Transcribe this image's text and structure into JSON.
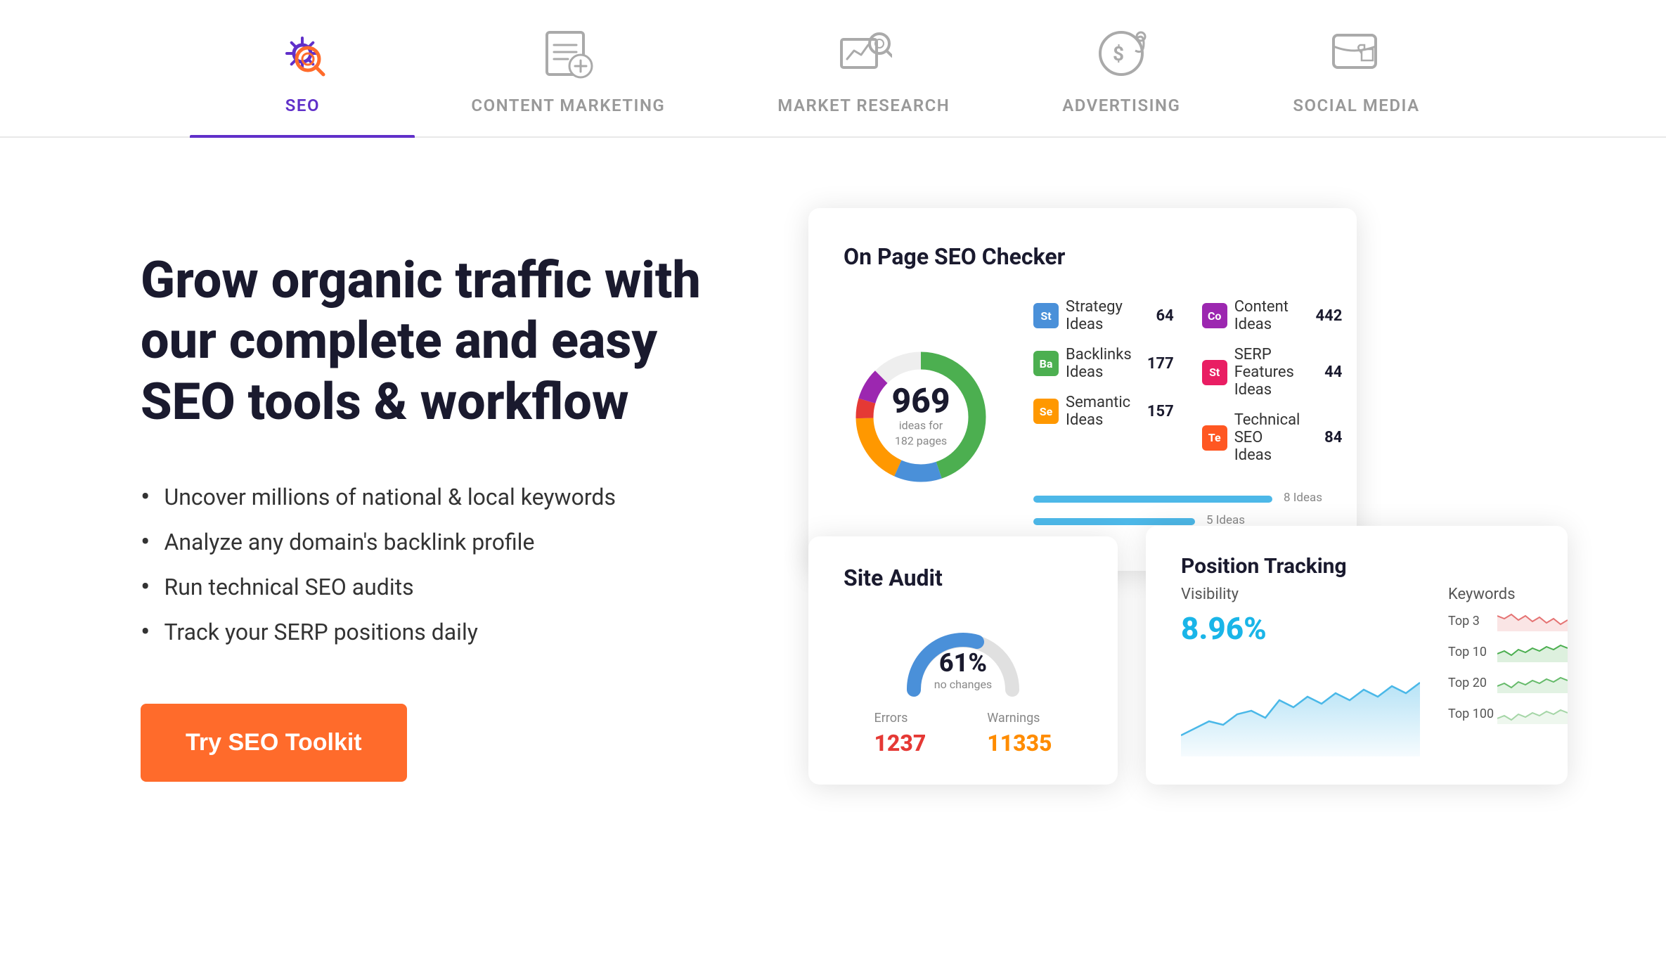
{
  "nav": {
    "tabs": [
      {
        "id": "seo",
        "label": "SEO",
        "active": true
      },
      {
        "id": "content-marketing",
        "label": "CONTENT MARKETING",
        "active": false
      },
      {
        "id": "market-research",
        "label": "MARKET RESEARCH",
        "active": false
      },
      {
        "id": "advertising",
        "label": "ADVERTISING",
        "active": false
      },
      {
        "id": "social-media",
        "label": "SOCIAL MEDIA",
        "active": false
      }
    ]
  },
  "hero": {
    "heading": "Grow organic traffic with our complete and easy SEO tools & workflow",
    "bullets": [
      "Uncover millions of national & local keywords",
      "Analyze any domain's backlink profile",
      "Run technical SEO audits",
      "Track your SERP positions daily"
    ],
    "cta_label": "Try SEO Toolkit"
  },
  "seo_checker": {
    "title": "On Page SEO Checker",
    "donut": {
      "number": "969",
      "sub_line1": "ideas for",
      "sub_line2": "182 pages"
    },
    "legend": [
      {
        "badge": "St",
        "color": "#4a90d9",
        "label": "Strategy Ideas",
        "count": "64"
      },
      {
        "badge": "Ba",
        "color": "#4caf50",
        "label": "Backlinks Ideas",
        "count": "177"
      },
      {
        "badge": "Se",
        "color": "#ff9800",
        "label": "Semantic Ideas",
        "count": "157"
      },
      {
        "badge": "Co",
        "color": "#9c27b0",
        "label": "Content Ideas",
        "count": "442"
      },
      {
        "badge": "St",
        "color": "#e91e63",
        "label": "SERP Features Ideas",
        "count": "44"
      },
      {
        "badge": "Te",
        "color": "#ff5722",
        "label": "Technical SEO Ideas",
        "count": "84"
      }
    ],
    "bars": [
      {
        "label": "8 Ideas",
        "width": "82"
      },
      {
        "label": "5 Ideas",
        "width": "55"
      }
    ]
  },
  "site_audit": {
    "title": "Site Audit",
    "gauge_percent": "61%",
    "gauge_sub": "no changes",
    "errors_label": "Errors",
    "errors_value": "1237",
    "warnings_label": "Warnings",
    "warnings_value": "11335"
  },
  "position_tracking": {
    "title": "Position Tracking",
    "visibility_label": "Visibility",
    "visibility_value": "8.96%",
    "keywords_label": "Keywords",
    "ranks": [
      {
        "label": "Top 3",
        "color": "#e57373"
      },
      {
        "label": "Top 10",
        "color": "#4caf50"
      },
      {
        "label": "Top 20",
        "color": "#66bb6a"
      },
      {
        "label": "Top 100",
        "color": "#a5d6a7"
      }
    ]
  }
}
